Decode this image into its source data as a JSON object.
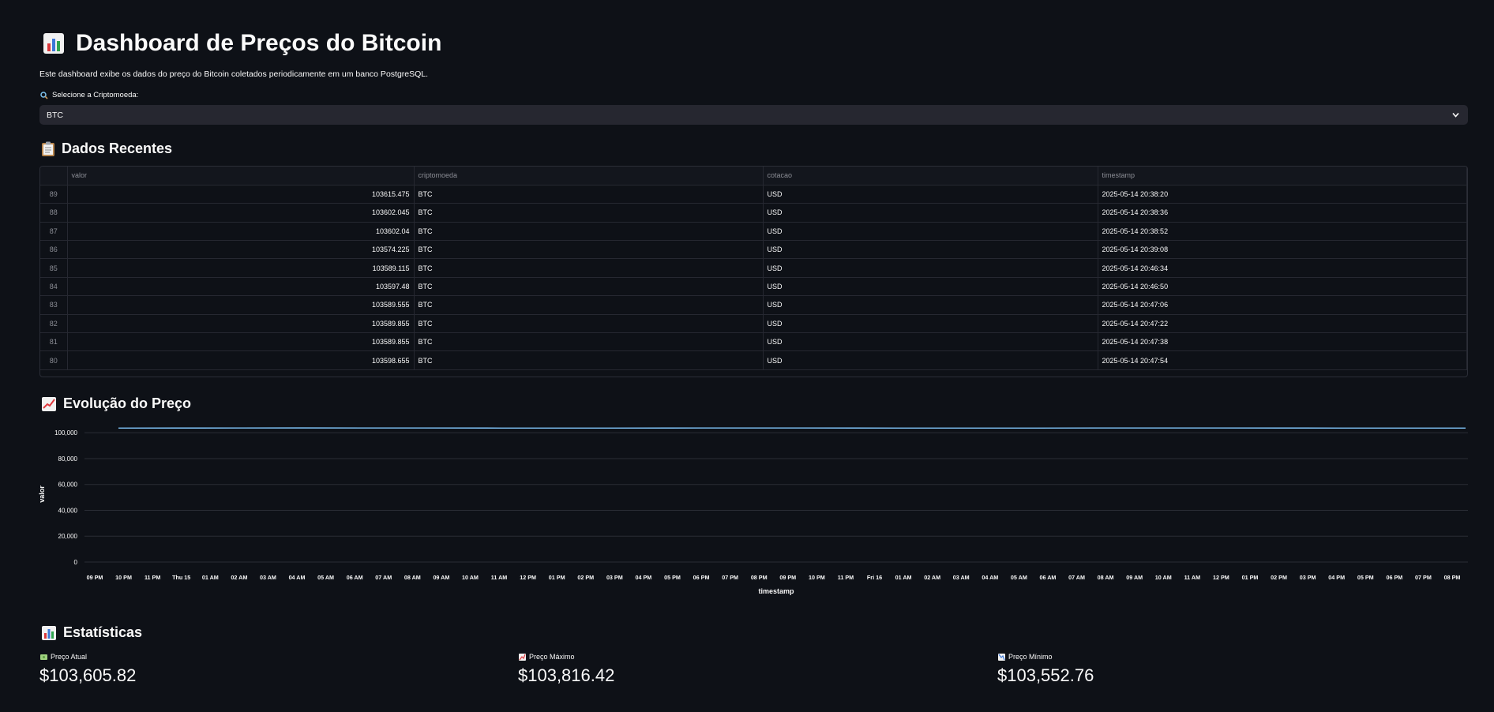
{
  "header": {
    "icon": "bar-chart-icon",
    "title": "Dashboard de Preços do Bitcoin",
    "description": "Este dashboard exibe os dados do preço do Bitcoin coletados periodicamente em um banco PostgreSQL."
  },
  "selector": {
    "icon": "magnifier-icon",
    "label": "Selecione a Criptomoeda:",
    "value": "BTC"
  },
  "recent": {
    "icon": "clipboard-icon",
    "title": "Dados Recentes",
    "columns": [
      "",
      "valor",
      "criptomoeda",
      "cotacao",
      "timestamp"
    ],
    "rows": [
      {
        "idx": "89",
        "valor": "103615.475",
        "cripto": "BTC",
        "cotacao": "USD",
        "timestamp": "2025-05-14 20:38:20"
      },
      {
        "idx": "88",
        "valor": "103602.045",
        "cripto": "BTC",
        "cotacao": "USD",
        "timestamp": "2025-05-14 20:38:36"
      },
      {
        "idx": "87",
        "valor": "103602.04",
        "cripto": "BTC",
        "cotacao": "USD",
        "timestamp": "2025-05-14 20:38:52"
      },
      {
        "idx": "86",
        "valor": "103574.225",
        "cripto": "BTC",
        "cotacao": "USD",
        "timestamp": "2025-05-14 20:39:08"
      },
      {
        "idx": "85",
        "valor": "103589.115",
        "cripto": "BTC",
        "cotacao": "USD",
        "timestamp": "2025-05-14 20:46:34"
      },
      {
        "idx": "84",
        "valor": "103597.48",
        "cripto": "BTC",
        "cotacao": "USD",
        "timestamp": "2025-05-14 20:46:50"
      },
      {
        "idx": "83",
        "valor": "103589.555",
        "cripto": "BTC",
        "cotacao": "USD",
        "timestamp": "2025-05-14 20:47:06"
      },
      {
        "idx": "82",
        "valor": "103589.855",
        "cripto": "BTC",
        "cotacao": "USD",
        "timestamp": "2025-05-14 20:47:22"
      },
      {
        "idx": "81",
        "valor": "103589.855",
        "cripto": "BTC",
        "cotacao": "USD",
        "timestamp": "2025-05-14 20:47:38"
      },
      {
        "idx": "80",
        "valor": "103598.655",
        "cripto": "BTC",
        "cotacao": "USD",
        "timestamp": "2025-05-14 20:47:54"
      }
    ]
  },
  "evolution": {
    "icon": "line-chart-icon",
    "title": "Evolução do Preço"
  },
  "chart_data": {
    "type": "line",
    "xlabel": "timestamp",
    "ylabel": "valor",
    "ylim": [
      0,
      105000
    ],
    "yticks": [
      0,
      20000,
      40000,
      60000,
      80000,
      100000
    ],
    "ytick_labels": [
      "0",
      "20,000",
      "40,000",
      "60,000",
      "80,000",
      "100,000"
    ],
    "xtick_labels": [
      "09 PM",
      "10 PM",
      "11 PM",
      "Thu 15",
      "01 AM",
      "02 AM",
      "03 AM",
      "04 AM",
      "05 AM",
      "06 AM",
      "07 AM",
      "08 AM",
      "09 AM",
      "10 AM",
      "11 AM",
      "12 PM",
      "01 PM",
      "02 PM",
      "03 PM",
      "04 PM",
      "05 PM",
      "06 PM",
      "07 PM",
      "08 PM",
      "09 PM",
      "10 PM",
      "11 PM",
      "Fri 16",
      "01 AM",
      "02 AM",
      "03 AM",
      "04 AM",
      "05 AM",
      "06 AM",
      "07 AM",
      "08 AM",
      "09 AM",
      "10 AM",
      "11 AM",
      "12 PM",
      "01 PM",
      "02 PM",
      "03 PM",
      "04 PM",
      "05 PM",
      "06 PM",
      "07 PM",
      "08 PM"
    ],
    "series": [
      {
        "values": [
          103600,
          103620,
          103650,
          103700,
          103680,
          103650,
          103620,
          103600,
          103610,
          103630,
          103650,
          103640,
          103620,
          103600,
          103590,
          103610,
          103640,
          103660,
          103650,
          103630,
          103610,
          103600,
          103605
        ]
      }
    ],
    "line_color": "#83c9ff",
    "grid": true
  },
  "stats": {
    "icon": "bar-chart-icon",
    "title": "Estatísticas",
    "items": [
      {
        "icon": "banknote-icon",
        "label": "Preço Atual",
        "value": "$103,605.82"
      },
      {
        "icon": "chart-up-icon",
        "label": "Preço Máximo",
        "value": "$103,816.42"
      },
      {
        "icon": "chart-down-icon",
        "label": "Preço Mínimo",
        "value": "$103,552.76"
      }
    ]
  }
}
